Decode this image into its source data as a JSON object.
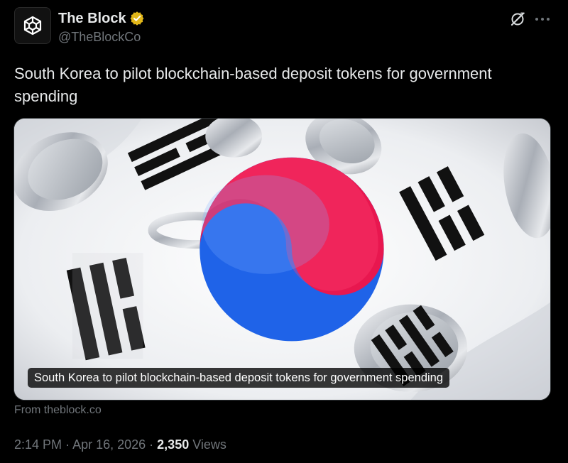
{
  "author": {
    "display_name": "The Block",
    "handle": "@TheBlockCo",
    "avatar_icon": "the-block-cube-logo",
    "verified_icon": "gold-verified-badge",
    "verified_color": "#e2b719"
  },
  "header_actions": {
    "grok_icon": "grok-icon",
    "more_icon": "more-horizontal-icon"
  },
  "tweet": {
    "text": "South Korea to pilot blockchain-based deposit tokens for government spending"
  },
  "card": {
    "image_description_icon": "south-korea-flag-with-coins-image",
    "caption": "South Korea to pilot blockchain-based deposit tokens for government spending",
    "source": "From theblock.co"
  },
  "meta": {
    "time": "2:14 PM",
    "separator": "·",
    "date": "Apr 16, 2026",
    "views_count": "2,350",
    "views_label": "Views"
  },
  "colors": {
    "background": "#000000",
    "primary_text": "#e7e9ea",
    "secondary_text": "#71767b",
    "border": "#2f3336",
    "flag_red": "#e8174f",
    "flag_blue": "#1f63e8"
  }
}
